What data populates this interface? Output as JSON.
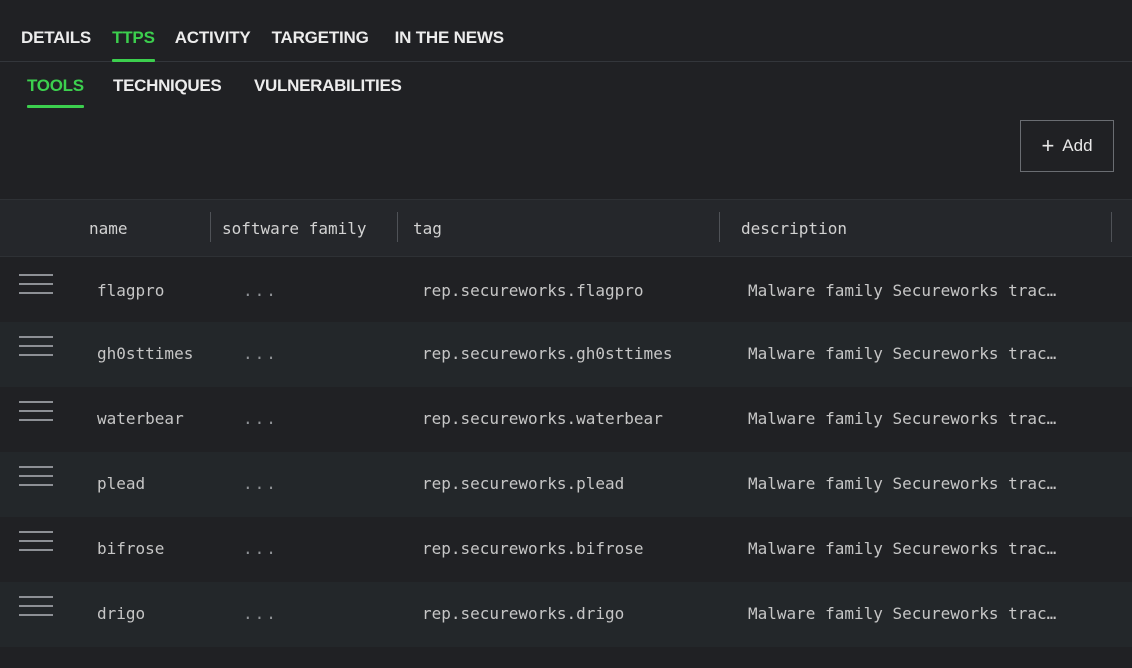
{
  "primary_tabs": [
    {
      "label": "DETAILS",
      "active": false
    },
    {
      "label": "TTPS",
      "active": true
    },
    {
      "label": "ACTIVITY",
      "active": false
    },
    {
      "label": "TARGETING",
      "active": false
    },
    {
      "label": "IN THE NEWS",
      "active": false
    }
  ],
  "secondary_tabs": [
    {
      "label": "TOOLS",
      "active": true
    },
    {
      "label": "TECHNIQUES",
      "active": false
    },
    {
      "label": "VULNERABILITIES",
      "active": false
    }
  ],
  "add_button": {
    "icon": "plus-icon",
    "label": "Add"
  },
  "table": {
    "columns": [
      "name",
      "software family",
      "tag",
      "description"
    ],
    "rows": [
      {
        "name": "flagpro",
        "software_family": "...",
        "tag": "rep.secureworks.flagpro",
        "description": "Malware family Secureworks trac…"
      },
      {
        "name": "gh0sttimes",
        "software_family": "...",
        "tag": "rep.secureworks.gh0sttimes",
        "description": "Malware family Secureworks trac…"
      },
      {
        "name": "waterbear",
        "software_family": "...",
        "tag": "rep.secureworks.waterbear",
        "description": "Malware family Secureworks trac…"
      },
      {
        "name": "plead",
        "software_family": "...",
        "tag": "rep.secureworks.plead",
        "description": "Malware family Secureworks trac…"
      },
      {
        "name": "bifrose",
        "software_family": "...",
        "tag": "rep.secureworks.bifrose",
        "description": "Malware family Secureworks trac…"
      },
      {
        "name": "drigo",
        "software_family": "...",
        "tag": "rep.secureworks.drigo",
        "description": "Malware family Secureworks trac…"
      }
    ]
  },
  "colors": {
    "background": "#202124",
    "accent": "#3ccf4e",
    "row_alt": "#23272a"
  }
}
